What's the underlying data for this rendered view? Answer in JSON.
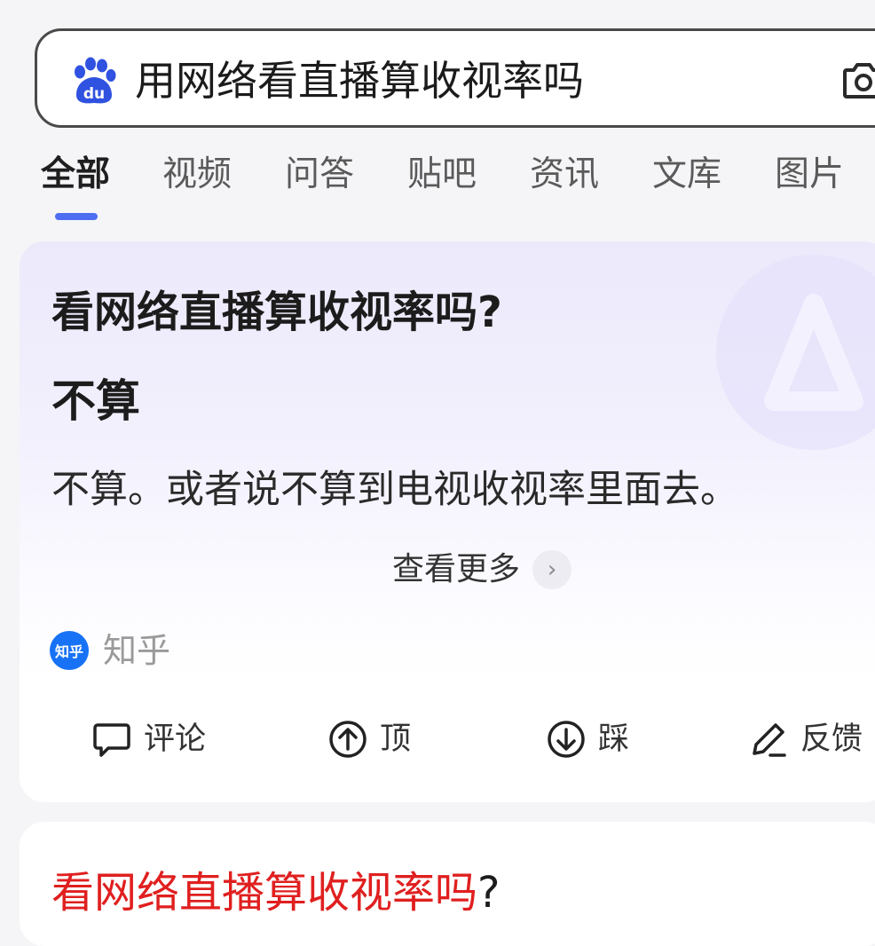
{
  "search": {
    "query": "用网络看直播算收视率吗"
  },
  "tabs": [
    {
      "label": "全部",
      "active": true
    },
    {
      "label": "视频"
    },
    {
      "label": "问答"
    },
    {
      "label": "贴吧"
    },
    {
      "label": "资讯"
    },
    {
      "label": "文库"
    },
    {
      "label": "图片"
    }
  ],
  "answer_card": {
    "title": "看网络直播算收视率吗?",
    "answer": "不算",
    "body": "不算。或者说不算到电视收视率里面去。",
    "more_label": "查看更多",
    "source_badge": "知乎",
    "source_name": "知乎",
    "actions": {
      "comment": "评论",
      "upvote": "顶",
      "downvote": "踩",
      "feedback": "反馈"
    }
  },
  "result_card": {
    "title_highlight": "看网络直播算收视率吗",
    "title_rest": "?"
  },
  "colors": {
    "accent": "#4e6ef2",
    "highlight": "#e01f1f",
    "zhihu": "#1772f6"
  }
}
